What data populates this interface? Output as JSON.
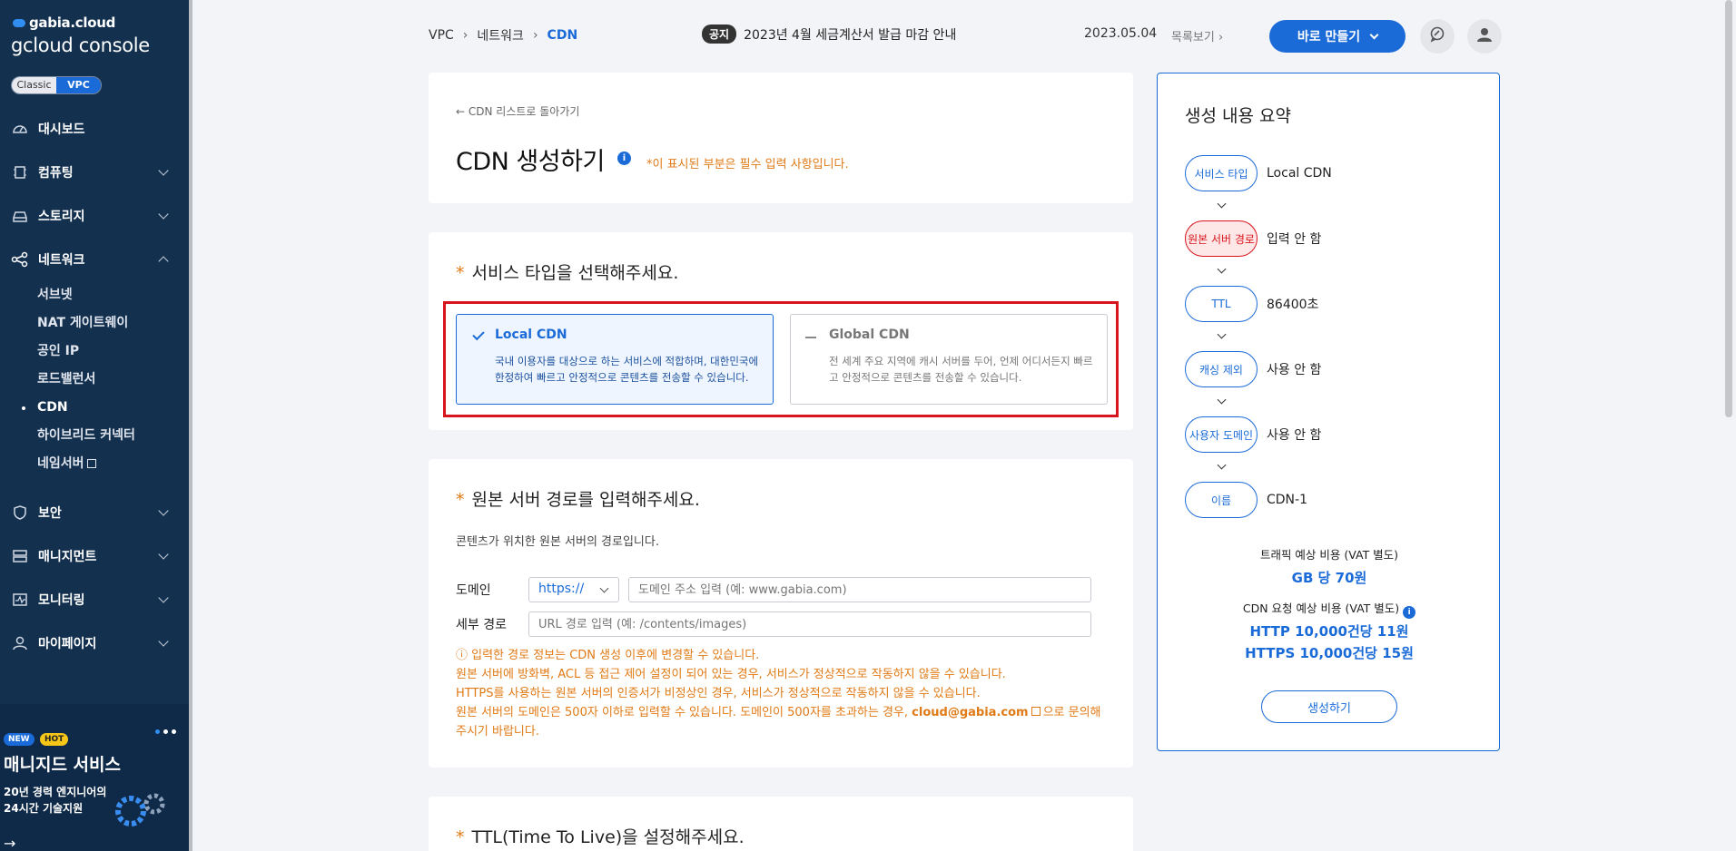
{
  "sidebar": {
    "logo_top": "gabia.cloud",
    "logo_bottom": "gcloud console",
    "mode_classic": "Classic",
    "mode_vpc": "VPC",
    "items": [
      {
        "label": "대시보드",
        "icon": "dashboard-icon"
      },
      {
        "label": "컴퓨팅",
        "icon": "chip-icon"
      },
      {
        "label": "스토리지",
        "icon": "storage-icon"
      },
      {
        "label": "네트워크",
        "icon": "network-icon"
      },
      {
        "label": "보안",
        "icon": "shield-icon"
      },
      {
        "label": "매니지먼트",
        "icon": "management-icon"
      },
      {
        "label": "모니터링",
        "icon": "monitor-icon"
      },
      {
        "label": "마이페이지",
        "icon": "user-icon"
      }
    ],
    "network_sub": [
      "서브넷",
      "NAT 게이트웨이",
      "공인 IP",
      "로드밸런서",
      "CDN",
      "하이브리드 커넥터",
      "네임서버"
    ],
    "promo": {
      "badge_new": "NEW",
      "badge_hot": "HOT",
      "title": "매니지드 서비스",
      "desc_line1": "20년 경력 엔지니어의",
      "desc_line2": "24시간 기술지원",
      "arrow": "→"
    }
  },
  "header": {
    "breadcrumb": [
      "VPC",
      "네트워크",
      "CDN"
    ],
    "breadcrumb_sep": "›",
    "notice_tag": "공지",
    "notice_text": "2023년 4월 세금계산서 발급 마감 안내",
    "date": "2023.05.04",
    "list_link": "목록보기 ›",
    "build_button": "바로 만들기"
  },
  "page": {
    "back_link": "← CDN 리스트로 돌아가기",
    "title": "CDN 생성하기",
    "info_glyph": "i",
    "required_note": "*이 표시된 부분은 필수 입력 사항입니다.",
    "star": "*"
  },
  "service_type": {
    "heading": "서비스 타입을 선택해주세요.",
    "options": [
      {
        "title": "Local CDN",
        "desc": "국내 이용자를 대상으로 하는 서비스에 적합하며, 대한민국에 한정하여 빠르고 안정적으로 콘텐츠를 전송할 수 있습니다.",
        "selected": true
      },
      {
        "title": "Global CDN",
        "desc": "전 세계 주요 지역에 캐시 서버를 두어, 언제 어디서든지 빠르고 안정적으로 콘텐츠를 전송할 수 있습니다.",
        "selected": false
      }
    ]
  },
  "origin": {
    "heading": "원본 서버 경로를 입력해주세요.",
    "desc": "콘텐츠가 위치한 원본 서버의 경로입니다.",
    "domain_label": "도메인",
    "protocol_value": "https://",
    "domain_placeholder": "도메인 주소 입력 (예: www.gabia.com)",
    "path_label": "세부 경로",
    "path_placeholder": "URL 경로 입력 (예: /contents/images)",
    "warn_line1": "ⓘ 입력한 경로 정보는 CDN 생성 이후에 변경할 수 있습니다.",
    "warn_line2": "원본 서버에 방화벽, ACL 등 접근 제어 설정이 되어 있는 경우, 서비스가 정상적으로 작동하지 않을 수 있습니다.",
    "warn_line3": "HTTPS를 사용하는 원본 서버의 인증서가 비정상인 경우, 서비스가 정상적으로 작동하지 않을 수 있습니다.",
    "warn_line4_pre": "원본 서버의 도메인은 500자 이하로 입력할 수 있습니다. 도메인이 500자를 초과하는 경우,",
    "warn_email": "cloud@gabia.com",
    "warn_line4_post": "으로 문의해 주시기 바랍니다."
  },
  "ttl": {
    "heading": "TTL(Time To Live)을 설정해주세요."
  },
  "summary": {
    "title": "생성 내용 요약",
    "rows": [
      {
        "pill": "서비스 타입",
        "value": "Local CDN",
        "error": false
      },
      {
        "pill": "원본 서버 경로",
        "value": "입력 안 함",
        "error": true
      },
      {
        "pill": "TTL",
        "value": "86400초",
        "error": false
      },
      {
        "pill": "캐싱 제외",
        "value": "사용 안 함",
        "error": false
      },
      {
        "pill": "사용자 도메인",
        "value": "사용 안 함",
        "error": false
      },
      {
        "pill": "이름",
        "value": "CDN-1",
        "error": false
      }
    ],
    "traffic_label": "트래픽 예상 비용 (VAT 별도)",
    "traffic_value": "GB 당 70원",
    "request_label": "CDN 요청 예상 비용 (VAT 별도)",
    "request_http": "HTTP 10,000건당 11원",
    "request_https": "HTTPS 10,000건당 15원",
    "create_button": "생성하기"
  },
  "colors": {
    "accent": "#1a6bd8",
    "sidebar_bg": "#13304f",
    "warning": "#e07a16",
    "error": "#d9141c"
  }
}
